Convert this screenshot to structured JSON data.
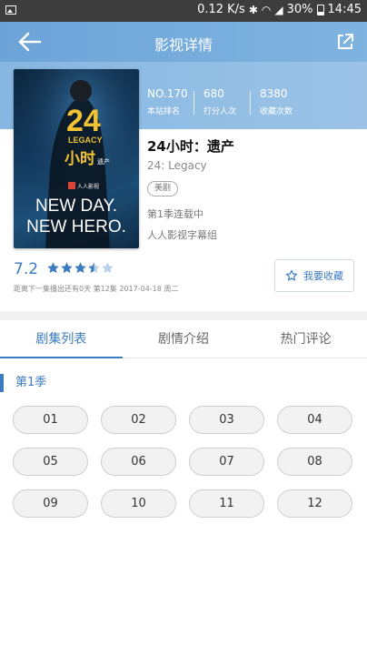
{
  "status_bar": {
    "speed": "0.12 K/s",
    "battery_pct": "30%",
    "time": "14:45"
  },
  "header": {
    "title": "影视详情",
    "back_icon": "arrow-left-icon",
    "share_icon": "share-external-icon"
  },
  "stats": [
    {
      "value": "NO.170",
      "label": "本站排名"
    },
    {
      "value": "680",
      "label": "打分人次"
    },
    {
      "value": "8380",
      "label": "收藏次数"
    }
  ],
  "poster": {
    "title_24": "24",
    "legacy": "LEGACY",
    "cn_title": "小时",
    "cn_sub": "遗产",
    "brand": "人人影视",
    "tagline_1": "NEW DAY.",
    "tagline_2": "NEW HERO."
  },
  "show": {
    "title": "24小时：遗产",
    "subtitle": "24: Legacy",
    "tag": "美剧",
    "status": "第1季连载中",
    "subgroup": "人人影视字幕组"
  },
  "rating": {
    "value": "7.2",
    "stars_filled": 3.5,
    "stars_total": 5,
    "next_air": "距离下一集播出还有0天 第12集 2017-04-18 周二"
  },
  "collect_button": {
    "label": "我要收藏",
    "icon": "star-outline-icon"
  },
  "tabs": [
    {
      "label": "剧集列表",
      "active": true
    },
    {
      "label": "剧情介绍",
      "active": false
    },
    {
      "label": "热门评论",
      "active": false
    }
  ],
  "season": {
    "label": "第1季",
    "episodes": [
      "01",
      "02",
      "03",
      "04",
      "05",
      "06",
      "07",
      "08",
      "09",
      "10",
      "11",
      "12"
    ]
  },
  "colors": {
    "accent": "#3c7bbf",
    "header_bg": "#6da4d8",
    "star": "#3c7bbf",
    "star_empty": "#b9d2ec"
  }
}
